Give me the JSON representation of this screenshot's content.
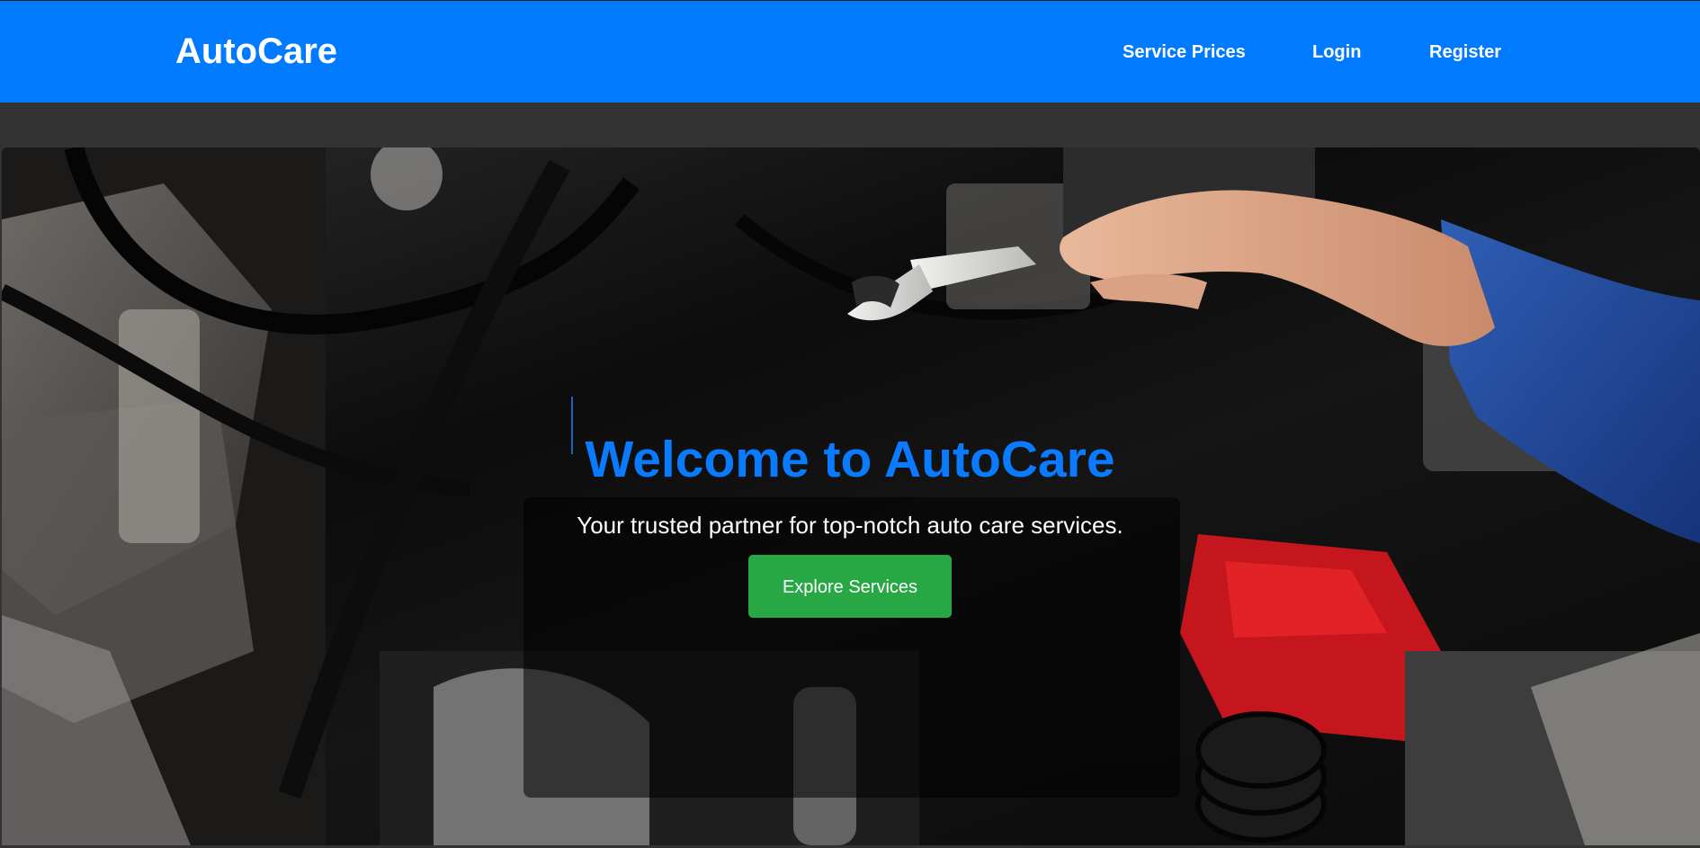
{
  "navbar": {
    "brand": "AutoCare",
    "links": [
      {
        "label": "Service Prices"
      },
      {
        "label": "Login"
      },
      {
        "label": "Register"
      }
    ]
  },
  "hero": {
    "title": "Welcome to AutoCare",
    "subtitle": "Your trusted partner for top-notch auto care services.",
    "cta_label": "Explore Services"
  },
  "colors": {
    "navbar": "#007bff",
    "accent": "#0a7bff",
    "cta": "#28a745",
    "page_background": "#333333"
  }
}
